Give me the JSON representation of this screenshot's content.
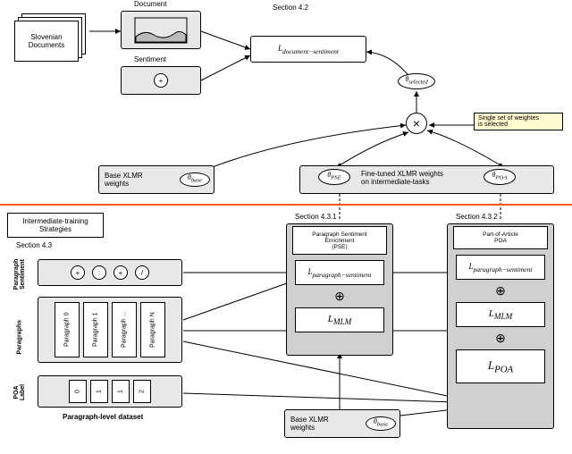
{
  "top": {
    "slovenian_docs": "Slovenian\nDocuments",
    "document_label": "Document",
    "sentiment_label": "Sentiment",
    "section_top": "Section 4.2",
    "loss_doc_sent": "L",
    "loss_doc_sent_sub": "document−sentiment",
    "sentiment_plus": "+",
    "theta_selected": "θ",
    "theta_selected_sub": "selected",
    "base_xlmr": "Base XLMR\nweights",
    "theta_base": "θ",
    "theta_base_sub": "base",
    "ft_xlmr": "Fine-tuned XLMR weights\non intermediate-tasks",
    "theta_pse": "θ",
    "theta_pse_sub": "PSE",
    "theta_poa": "θ",
    "theta_poa_sub": "POA",
    "note": "Single set of weightes\nis selected",
    "times_symbol": "×"
  },
  "divider_color": "#ff5a1a",
  "bottom": {
    "intermediate_box": "Intermediate-training\nStrategies",
    "section_43": "Section 4.3",
    "row_labels": {
      "paragraph_sentiment": "Paragraph\nSentiment",
      "paragraphs": "Paragraphs",
      "poa_label": "POA\nLabel"
    },
    "sentiment_icons": [
      "+",
      ":",
      "+",
      "/"
    ],
    "paragraphs": [
      "Paragraph 0",
      "Paragraph 1",
      "Paragraph ...",
      "Paragraph N"
    ],
    "poa_values": [
      "0",
      "1",
      "1",
      "2"
    ],
    "dataset_label": "Paragraph-level dataset",
    "section_431": "Section 4.3.1",
    "section_432": "Section 4.3.2",
    "pse_title": "Paragraph Sentiment\nEnrichment\n(PSE)",
    "poa_title": "Part-of-Article\nPOA",
    "l_para_sent": "L",
    "l_para_sent_sub": "paragraph−sentiment",
    "l_mlm": "L",
    "l_mlm_sub": "MLM",
    "l_poa": "L",
    "l_poa_sub": "POA",
    "plus_op": "⊕",
    "base_xlmr2": "Base XLMR\nweights",
    "theta_base2": "θ",
    "theta_base2_sub": "base"
  }
}
